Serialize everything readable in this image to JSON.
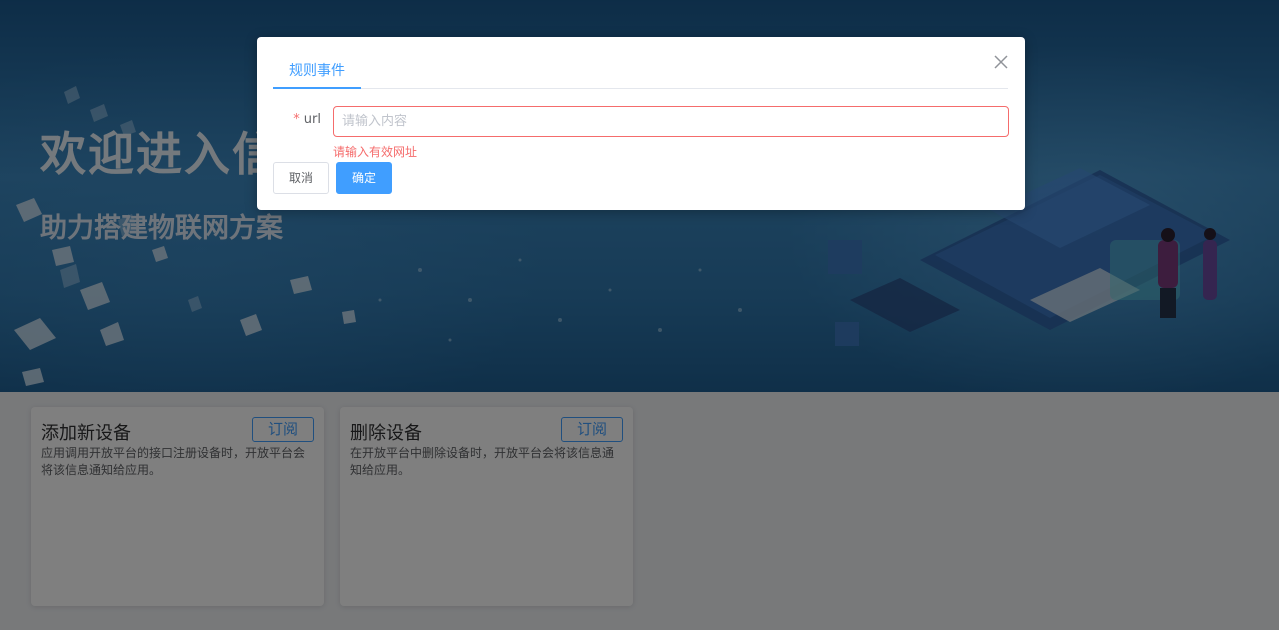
{
  "banner": {
    "title": "欢迎进入信",
    "subtitle": "助力搭建物联网方案"
  },
  "cards": [
    {
      "title": "添加新设备",
      "description": "应用调用开放平台的接口注册设备时，开放平台会将该信息通知给应用。",
      "button": "订阅"
    },
    {
      "title": "删除设备",
      "description": "在开放平台中删除设备时，开放平台会将该信息通知给应用。",
      "button": "订阅"
    }
  ],
  "dialog": {
    "tab_label": "规则事件",
    "field": {
      "required_mark": "*",
      "label": "url",
      "placeholder": "请输入内容",
      "value": "",
      "error": "请输入有效网址"
    },
    "cancel_label": "取消",
    "confirm_label": "确定"
  },
  "colors": {
    "accent": "#409eff",
    "error": "#f56c6c",
    "overlay": "rgba(0,0,0,0.5)"
  },
  "icons": {
    "close": "close-icon"
  }
}
